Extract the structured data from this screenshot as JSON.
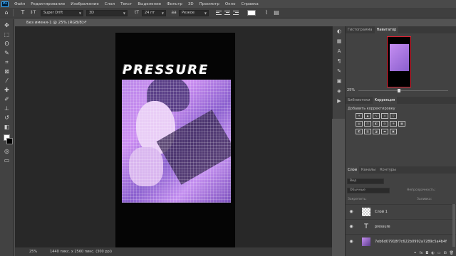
{
  "menubar": {
    "logo": "Ps",
    "items": [
      "Файл",
      "Редактирование",
      "Изображение",
      "Слои",
      "Текст",
      "Выделение",
      "Фильтр",
      "3D",
      "Просмотр",
      "Окно",
      "Справка"
    ]
  },
  "options": {
    "tool_icon": "T",
    "font_family": "Super Drift",
    "font_style": "3D",
    "font_size": "24 пт",
    "antialias": "Резкое",
    "text_color": "#ffffff"
  },
  "document": {
    "tab_title": "Без имени-1 @ 25% (RGB/8) *",
    "close_glyph": "×",
    "headline": "PRESSURE",
    "photo_colors": [
      "#b986e8",
      "#7d52be"
    ]
  },
  "status": {
    "zoom": "25%",
    "dimensions": "1440 пикс. x 2560 пикс. (300 ppi)"
  },
  "panels": {
    "top_tabs": [
      "Гистограмма",
      "Навигатор"
    ],
    "zoom_value": "25%",
    "corr_tabs": [
      "Библиотеки",
      "Коррекция"
    ],
    "corr_label": "Добавить корректировку",
    "layer_tabs": [
      "Слои",
      "Каналы",
      "Контуры"
    ],
    "kind_filter": "Вид",
    "blend_mode": "Обычные",
    "opacity_label": "Непрозрачность:",
    "lock_label": "Закрепить:",
    "fill_label": "Заливка:",
    "layers": [
      {
        "name": "Слой 1",
        "thumb": "blank"
      },
      {
        "name": "pressure",
        "thumb": "T"
      },
      {
        "name": "7eb6d07918f7c622b0992a7289c5a4b4f",
        "thumb": "img"
      }
    ],
    "footer_icons": [
      "link",
      "fx",
      "mask",
      "adjust",
      "folder",
      "new",
      "trash"
    ]
  },
  "colors": {
    "accent": "#31a8ff",
    "panel": "#424242",
    "canvas": "#282828"
  }
}
